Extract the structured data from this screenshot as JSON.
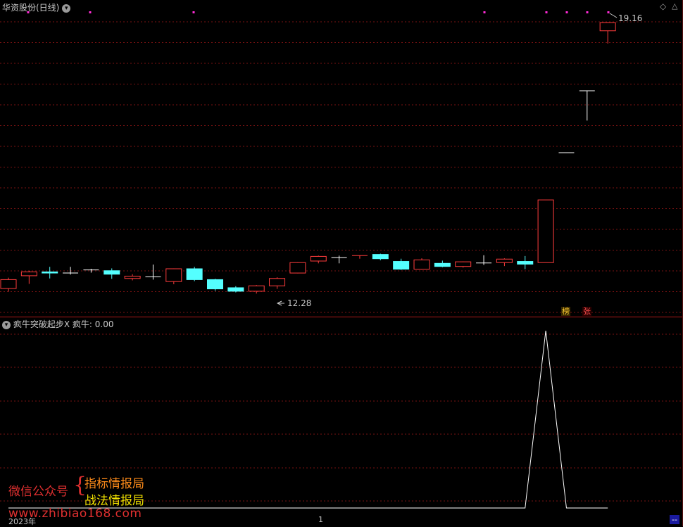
{
  "main_panel": {
    "title": "华资股份(日线)",
    "price_high_label": "19.16",
    "price_low_label": "12.28",
    "badge_1": "榜",
    "badge_2": "张"
  },
  "indicator_panel": {
    "name": "疯牛突破起步",
    "close_mark": "X",
    "value_label": "疯牛: 0.00"
  },
  "watermark": {
    "line1": "微信公众号",
    "brace": "{",
    "line2": "指标情报局",
    "line3": "战法情报局",
    "url": "www.zhibiao168.com"
  },
  "status_bar": {
    "year": "2023年",
    "page": "1",
    "button": "--"
  },
  "colors": {
    "up": "#ff3c3c",
    "down": "#54ffff",
    "grid": "#7a1212",
    "indicator_line": "#ffffff"
  },
  "chart_data": {
    "type": "candlestick",
    "price_range": [
      11.6,
      19.6
    ],
    "candles": [
      {
        "o": 12.29,
        "c": 12.52,
        "h": 12.57,
        "l": 12.21
      },
      {
        "o": 12.62,
        "c": 12.72,
        "h": 12.75,
        "l": 12.41
      },
      {
        "o": 12.72,
        "c": 12.69,
        "h": 12.85,
        "l": 12.55
      },
      {
        "o": 12.69,
        "c": 12.68,
        "h": 12.85,
        "l": 12.65
      },
      {
        "o": 12.77,
        "c": 12.75,
        "h": 12.8,
        "l": 12.7
      },
      {
        "o": 12.75,
        "c": 12.66,
        "h": 12.81,
        "l": 12.54
      },
      {
        "o": 12.55,
        "c": 12.61,
        "h": 12.66,
        "l": 12.5
      },
      {
        "o": 12.59,
        "c": 12.57,
        "h": 12.91,
        "l": 12.52
      },
      {
        "o": 12.47,
        "c": 12.8,
        "h": 12.81,
        "l": 12.4
      },
      {
        "o": 12.8,
        "c": 12.52,
        "h": 12.85,
        "l": 12.48
      },
      {
        "o": 12.52,
        "c": 12.28,
        "h": 12.54,
        "l": 12.23
      },
      {
        "o": 12.31,
        "c": 12.22,
        "h": 12.35,
        "l": 12.19
      },
      {
        "o": 12.22,
        "c": 12.36,
        "h": 12.38,
        "l": 12.16
      },
      {
        "o": 12.36,
        "c": 12.55,
        "h": 12.58,
        "l": 12.28
      },
      {
        "o": 12.69,
        "c": 12.96,
        "h": 12.97,
        "l": 12.68
      },
      {
        "o": 13.0,
        "c": 13.12,
        "h": 13.14,
        "l": 12.94
      },
      {
        "o": 13.08,
        "c": 13.09,
        "h": 13.14,
        "l": 12.94
      },
      {
        "o": 13.12,
        "c": 13.14,
        "h": 13.14,
        "l": 13.06
      },
      {
        "o": 13.17,
        "c": 13.06,
        "h": 13.19,
        "l": 13.02
      },
      {
        "o": 12.99,
        "c": 12.79,
        "h": 13.06,
        "l": 12.77
      },
      {
        "o": 12.79,
        "c": 13.03,
        "h": 13.07,
        "l": 12.78
      },
      {
        "o": 12.94,
        "c": 12.86,
        "h": 13.01,
        "l": 12.84
      },
      {
        "o": 12.86,
        "c": 12.98,
        "h": 12.99,
        "l": 12.83
      },
      {
        "o": 12.95,
        "c": 12.93,
        "h": 13.15,
        "l": 12.9
      },
      {
        "o": 12.96,
        "c": 13.05,
        "h": 13.07,
        "l": 12.87
      },
      {
        "o": 12.99,
        "c": 12.92,
        "h": 13.13,
        "l": 12.79
      },
      {
        "o": 12.96,
        "c": 14.58,
        "h": 14.58,
        "l": 12.96
      },
      {
        "o": 15.8,
        "c": 15.8,
        "h": 15.8,
        "l": 15.8
      },
      {
        "o": 17.4,
        "c": 17.4,
        "h": 17.4,
        "l": 16.63
      },
      {
        "o": 18.95,
        "c": 19.16,
        "h": 19.17,
        "l": 18.62
      }
    ],
    "indicator_values": [
      0,
      0,
      0,
      0,
      0,
      0,
      0,
      0,
      0,
      0,
      0,
      0,
      0,
      0,
      0,
      0,
      0,
      0,
      0,
      0,
      0,
      0,
      0,
      0,
      0,
      0,
      1,
      0,
      0,
      0
    ],
    "x_label": "2023年"
  }
}
